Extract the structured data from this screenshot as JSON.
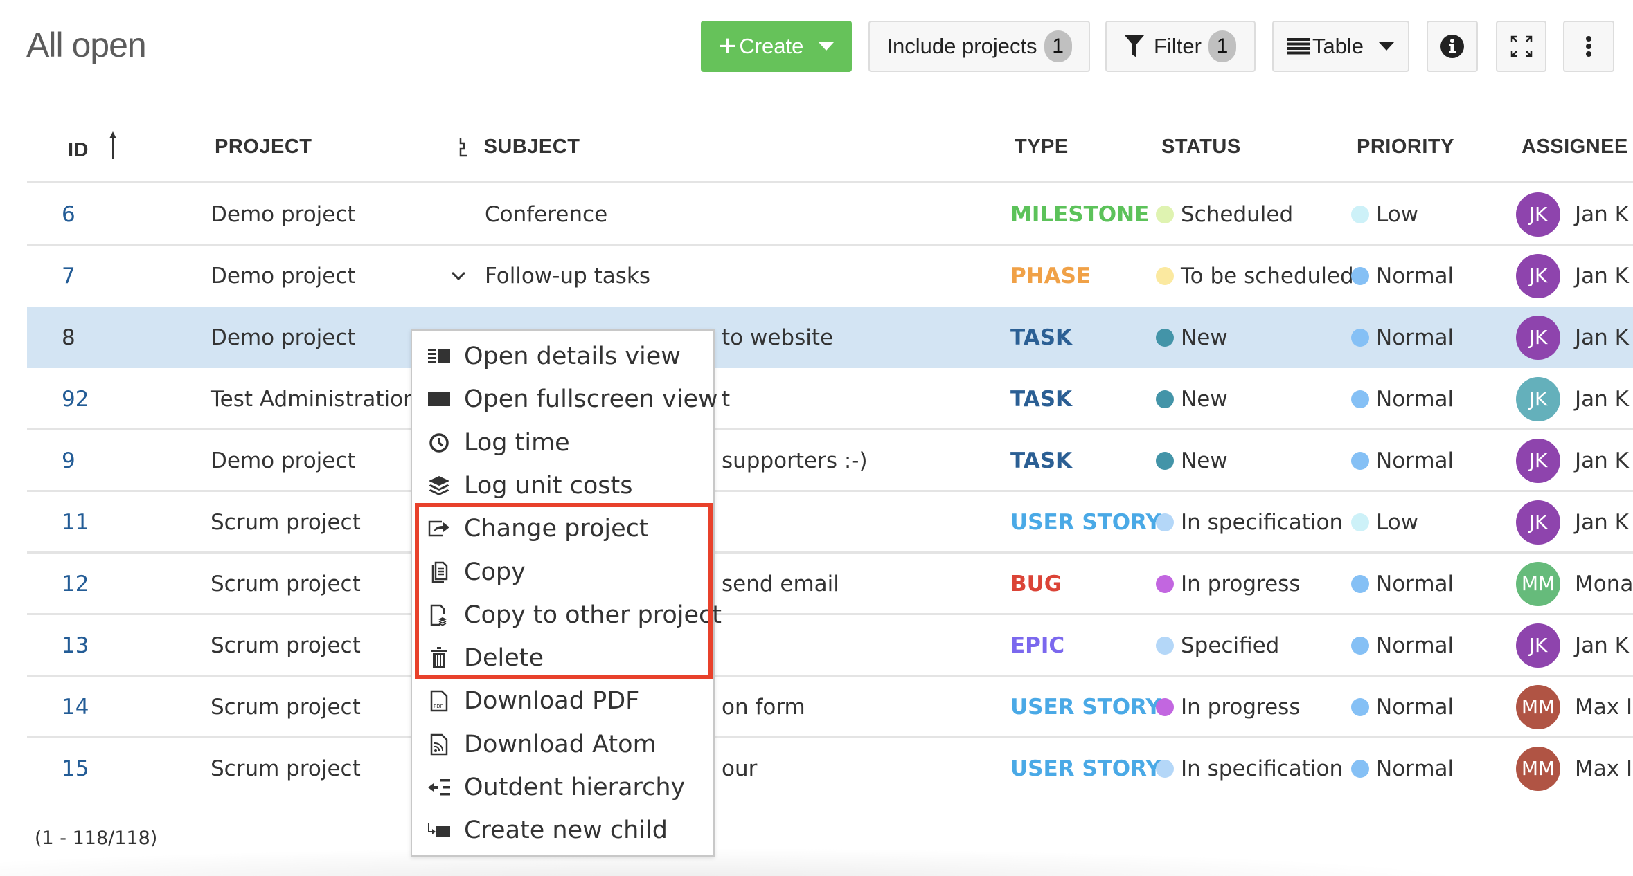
{
  "page": {
    "title": "All open"
  },
  "toolbar": {
    "create_label": "Create",
    "include_projects_label": "Include projects",
    "include_projects_count": "1",
    "filter_label": "Filter",
    "filter_count": "1",
    "view_mode_label": "Table",
    "icons": {
      "create": "plus-icon",
      "create_dropdown": "caret-down-icon",
      "filter": "funnel-icon",
      "table": "list-icon",
      "info": "info-icon",
      "fullscreen": "expand-icon",
      "more": "kebab-menu-icon"
    }
  },
  "table": {
    "columns": {
      "id": "ID",
      "project": "PROJECT",
      "subject": "SUBJECT",
      "type": "TYPE",
      "status": "STATUS",
      "priority": "PRIORITY",
      "assignee": "ASSIGNEE"
    },
    "sort": {
      "column": "ID",
      "direction": "ascending"
    },
    "rows": [
      {
        "id": "6",
        "project": "Demo project",
        "subject": "Conference",
        "expander": false,
        "type": "MILESTONE",
        "type_color": "#5cc25a",
        "status": "Scheduled",
        "status_color": "#dff3b1",
        "priority": "Low",
        "priority_color": "#cdf1f8",
        "assignee_initials": "JK",
        "assignee_color": "#8e44ad",
        "assignee_name": "Jan K",
        "selected": false
      },
      {
        "id": "7",
        "project": "Demo project",
        "subject": "Follow-up tasks",
        "expander": true,
        "type": "PHASE",
        "type_color": "#f0a147",
        "status": "To be scheduled",
        "status_color": "#fbe9a0",
        "priority": "Normal",
        "priority_color": "#85c0f5",
        "assignee_initials": "JK",
        "assignee_color": "#8e44ad",
        "assignee_name": "Jan K",
        "selected": false
      },
      {
        "id": "8",
        "project": "Demo project",
        "subject": "to website",
        "expander": false,
        "type": "TASK",
        "type_color": "#2b5f94",
        "status": "New",
        "status_color": "#4394a8",
        "priority": "Normal",
        "priority_color": "#85c0f5",
        "assignee_initials": "JK",
        "assignee_color": "#8e44ad",
        "assignee_name": "Jan K",
        "selected": true
      },
      {
        "id": "92",
        "project": "Test Administration",
        "subject": "t",
        "expander": false,
        "type": "TASK",
        "type_color": "#2b5f94",
        "status": "New",
        "status_color": "#4394a8",
        "priority": "Normal",
        "priority_color": "#85c0f5",
        "assignee_initials": "JK",
        "assignee_color": "#64b0bb",
        "assignee_name": "Jan K",
        "selected": false
      },
      {
        "id": "9",
        "project": "Demo project",
        "subject": "supporters :-)",
        "expander": false,
        "type": "TASK",
        "type_color": "#2b5f94",
        "status": "New",
        "status_color": "#4394a8",
        "priority": "Normal",
        "priority_color": "#85c0f5",
        "assignee_initials": "JK",
        "assignee_color": "#8e44ad",
        "assignee_name": "Jan K",
        "selected": false
      },
      {
        "id": "11",
        "project": "Scrum project",
        "subject": "",
        "expander": false,
        "type": "USER STORY",
        "type_color": "#4aa9e6",
        "status": "In specification",
        "status_color": "#b4d7f8",
        "priority": "Low",
        "priority_color": "#cdf1f8",
        "assignee_initials": "JK",
        "assignee_color": "#8e44ad",
        "assignee_name": "Jan K",
        "selected": false
      },
      {
        "id": "12",
        "project": "Scrum project",
        "subject": "send email",
        "expander": false,
        "type": "BUG",
        "type_color": "#db4437",
        "status": "In progress",
        "status_color": "#c266e0",
        "priority": "Normal",
        "priority_color": "#85c0f5",
        "assignee_initials": "MM",
        "assignee_color": "#66bb7b",
        "assignee_name": "Mona",
        "selected": false
      },
      {
        "id": "13",
        "project": "Scrum project",
        "subject": "",
        "expander": false,
        "type": "EPIC",
        "type_color": "#7b68ee",
        "status": "Specified",
        "status_color": "#b4d7f8",
        "priority": "Normal",
        "priority_color": "#85c0f5",
        "assignee_initials": "JK",
        "assignee_color": "#8e44ad",
        "assignee_name": "Jan K",
        "selected": false
      },
      {
        "id": "14",
        "project": "Scrum project",
        "subject": "on form",
        "expander": false,
        "type": "USER STORY",
        "type_color": "#4aa9e6",
        "status": "In progress",
        "status_color": "#c266e0",
        "priority": "Normal",
        "priority_color": "#85c0f5",
        "assignee_initials": "MM",
        "assignee_color": "#b05444",
        "assignee_name": "Max I",
        "selected": false
      },
      {
        "id": "15",
        "project": "Scrum project",
        "subject": "our",
        "expander": false,
        "type": "USER STORY",
        "type_color": "#4aa9e6",
        "status": "In specification",
        "status_color": "#b4d7f8",
        "priority": "Normal",
        "priority_color": "#85c0f5",
        "assignee_initials": "MM",
        "assignee_color": "#b05444",
        "assignee_name": "Max I",
        "selected": false
      }
    ],
    "pagination": "(1 - 118/118)"
  },
  "context_menu": {
    "items": [
      {
        "label": "Open details view",
        "icon": "split-view-icon",
        "highlighted": false
      },
      {
        "label": "Open fullscreen view",
        "icon": "fullscreen-view-icon",
        "highlighted": false
      },
      {
        "label": "Log time",
        "icon": "clock-icon",
        "highlighted": false
      },
      {
        "label": "Log unit costs",
        "icon": "layers-icon",
        "highlighted": false
      },
      {
        "label": "Change project",
        "icon": "move-icon",
        "highlighted": true
      },
      {
        "label": "Copy",
        "icon": "copy-icon",
        "highlighted": true
      },
      {
        "label": "Copy to other project",
        "icon": "copy-to-project-icon",
        "highlighted": true
      },
      {
        "label": "Delete",
        "icon": "trash-icon",
        "highlighted": true
      },
      {
        "label": "Download PDF",
        "icon": "pdf-file-icon",
        "highlighted": false
      },
      {
        "label": "Download Atom",
        "icon": "rss-file-icon",
        "highlighted": false
      },
      {
        "label": "Outdent hierarchy",
        "icon": "outdent-icon",
        "highlighted": false
      },
      {
        "label": "Create new child",
        "icon": "create-child-icon",
        "highlighted": false
      }
    ],
    "highlight_color": "#e8412b"
  },
  "colors": {
    "accent_create": "#66c25a",
    "selected_row": "#d3e4f3",
    "id_link": "#235c96"
  }
}
